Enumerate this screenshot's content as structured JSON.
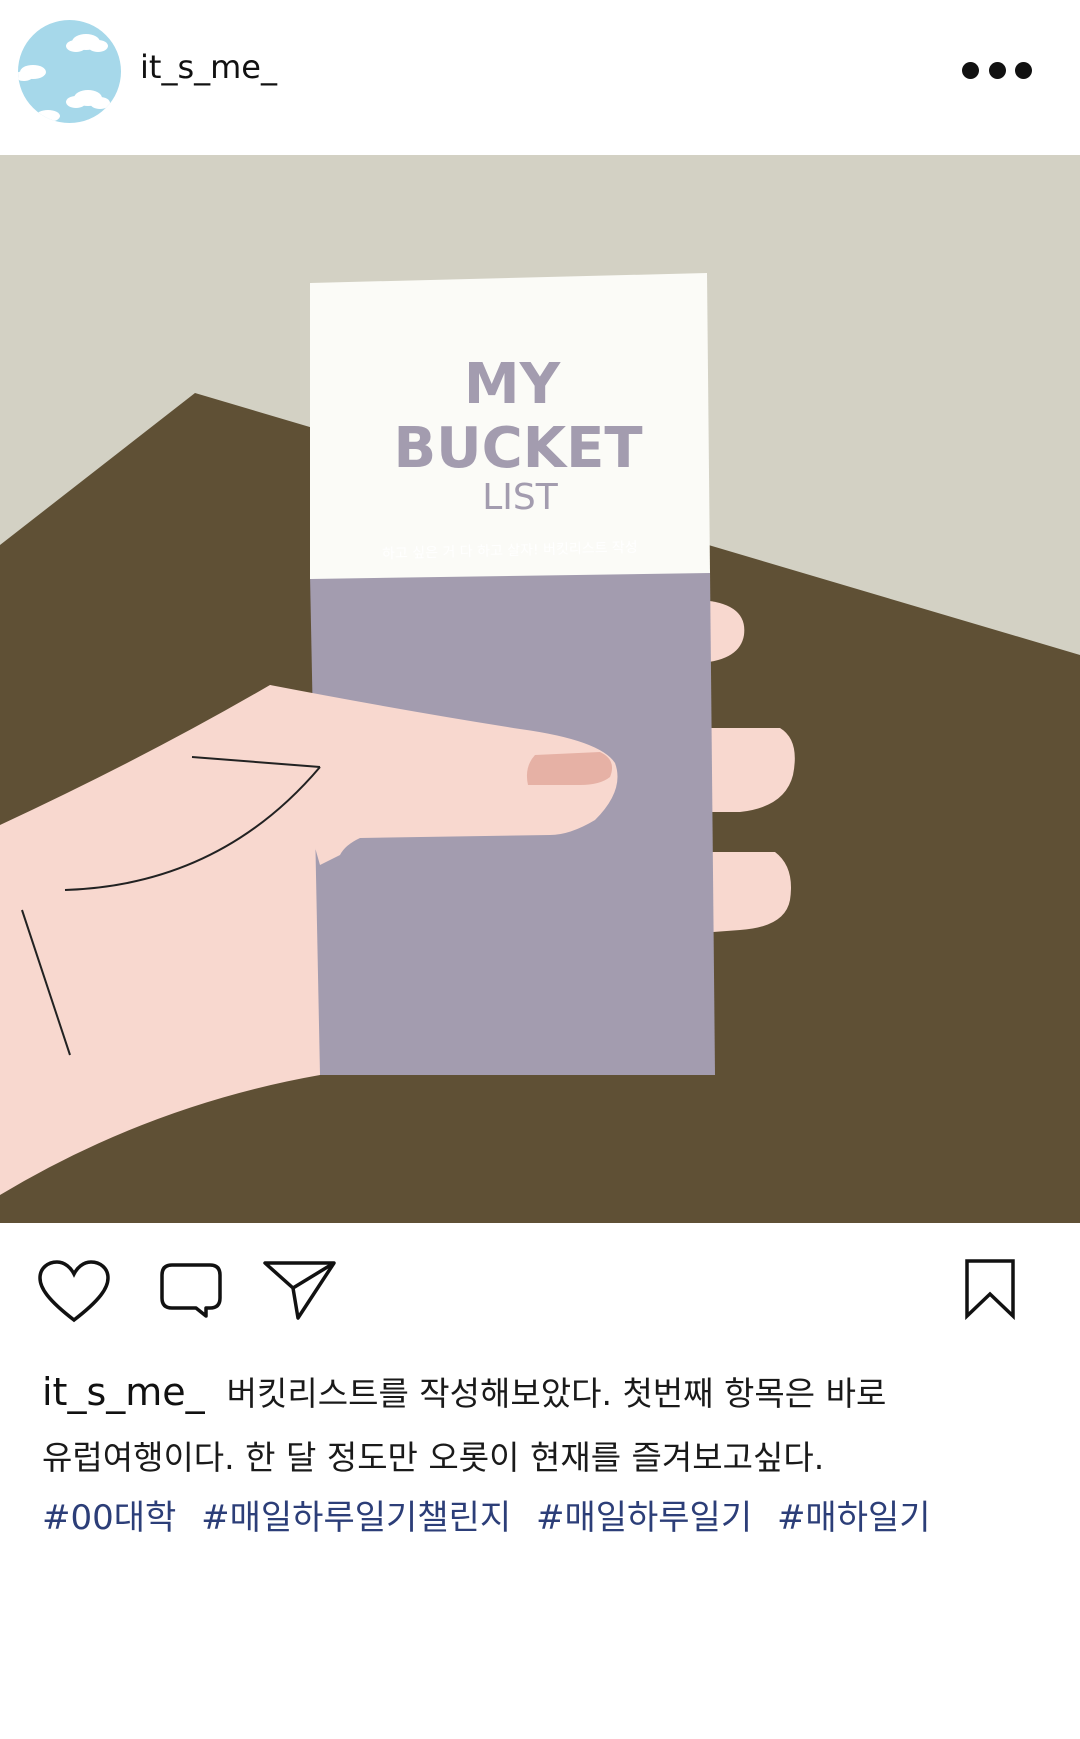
{
  "header": {
    "username": "it_s_me_",
    "avatar_icon": "sky-clouds-avatar",
    "more_icon": "more-dots-icon"
  },
  "photo": {
    "card_title_line1": "MY",
    "card_title_line2": "BUCKET",
    "card_title_line3": "LIST",
    "card_subtitle": "하고 싶은 거 다 하고 살자! 버킷리스트 작성"
  },
  "actions": {
    "like_icon": "heart-icon",
    "comment_icon": "comment-icon",
    "share_icon": "send-icon",
    "save_icon": "bookmark-icon"
  },
  "caption": {
    "username": "it_s_me_",
    "line1": "버킷리스트를 작성해보았다. 첫번째 항목은 바로",
    "line2": "유럽여행이다. 한 달 정도만 오롯이 현재를 즐겨보고싶다.",
    "hashtags": [
      "#00대학",
      "#매일하루일기챌린지",
      "#매일하루일기",
      "#매하일기"
    ]
  },
  "colors": {
    "background_gray": "#d3d1c4",
    "table_brown": "#5f5035",
    "card_top": "#fbfbf7",
    "card_bottom": "#a39caf",
    "card_text": "#a39caf",
    "skin": "#f8d8cf",
    "nail": "#e6b1a5",
    "hashtag": "#2c3e78",
    "sky": "#a6d8ea"
  }
}
